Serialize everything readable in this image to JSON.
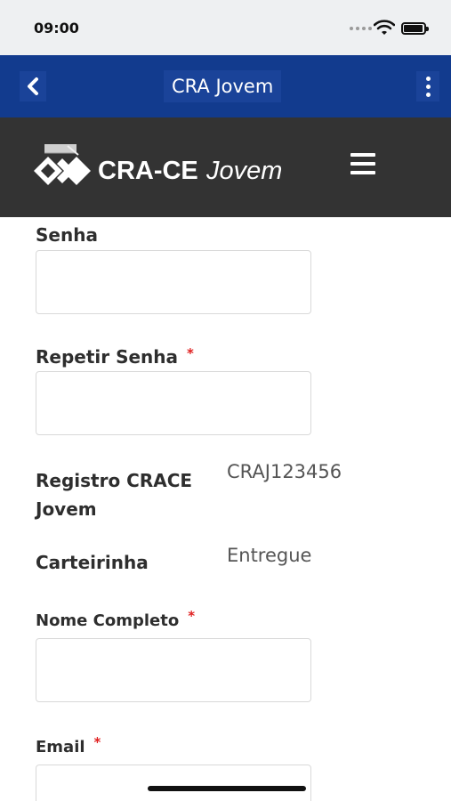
{
  "status_bar": {
    "time": "09:00"
  },
  "app_bar": {
    "title": "CRA Jovem"
  },
  "brand": {
    "name_bold": "CRA-CE",
    "name_italic": "Jovem"
  },
  "form": {
    "senha_label": "Senha",
    "repetir_senha_label": "Repetir Senha",
    "required_mark": "*",
    "registro_label_line1": "Registro CRACE",
    "registro_label_line2": "Jovem",
    "registro_value": "CRAJ123456",
    "carteirinha_label": "Carteirinha",
    "carteirinha_value": "Entregue",
    "nome_label": "Nome Completo",
    "email_label": "Email"
  },
  "colors": {
    "app_bar": "#123b8e",
    "brand_bar": "#333333",
    "required": "#e02020"
  }
}
